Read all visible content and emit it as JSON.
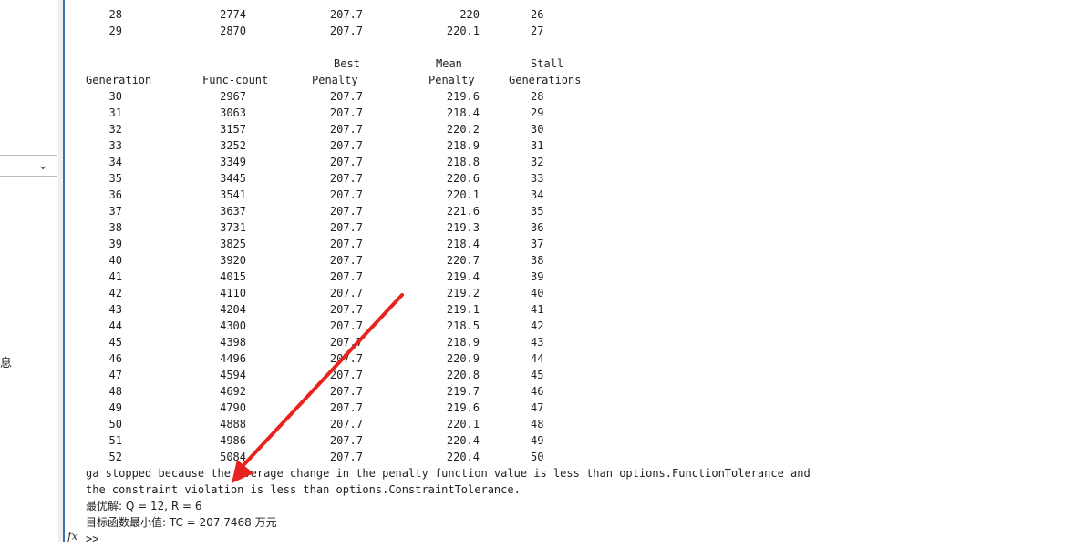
{
  "side_panel": {
    "partial_char": "息"
  },
  "console": {
    "top_rows": [
      {
        "gen": "28",
        "fc": "2774",
        "best": "207.7",
        "mean": "220",
        "stall": "26"
      },
      {
        "gen": "29",
        "fc": "2870",
        "best": "207.7",
        "mean": "220.1",
        "stall": "27"
      }
    ],
    "headers": {
      "best_top": "Best",
      "mean_top": "Mean",
      "stall_top": "Stall",
      "generation": "Generation",
      "func_count": "Func-count",
      "best_bottom": "Penalty",
      "mean_bottom": "Penalty",
      "stall_bottom": "Generations"
    },
    "rows": [
      {
        "gen": "30",
        "fc": "2967",
        "best": "207.7",
        "mean": "219.6",
        "stall": "28"
      },
      {
        "gen": "31",
        "fc": "3063",
        "best": "207.7",
        "mean": "218.4",
        "stall": "29"
      },
      {
        "gen": "32",
        "fc": "3157",
        "best": "207.7",
        "mean": "220.2",
        "stall": "30"
      },
      {
        "gen": "33",
        "fc": "3252",
        "best": "207.7",
        "mean": "218.9",
        "stall": "31"
      },
      {
        "gen": "34",
        "fc": "3349",
        "best": "207.7",
        "mean": "218.8",
        "stall": "32"
      },
      {
        "gen": "35",
        "fc": "3445",
        "best": "207.7",
        "mean": "220.6",
        "stall": "33"
      },
      {
        "gen": "36",
        "fc": "3541",
        "best": "207.7",
        "mean": "220.1",
        "stall": "34"
      },
      {
        "gen": "37",
        "fc": "3637",
        "best": "207.7",
        "mean": "221.6",
        "stall": "35"
      },
      {
        "gen": "38",
        "fc": "3731",
        "best": "207.7",
        "mean": "219.3",
        "stall": "36"
      },
      {
        "gen": "39",
        "fc": "3825",
        "best": "207.7",
        "mean": "218.4",
        "stall": "37"
      },
      {
        "gen": "40",
        "fc": "3920",
        "best": "207.7",
        "mean": "220.7",
        "stall": "38"
      },
      {
        "gen": "41",
        "fc": "4015",
        "best": "207.7",
        "mean": "219.4",
        "stall": "39"
      },
      {
        "gen": "42",
        "fc": "4110",
        "best": "207.7",
        "mean": "219.2",
        "stall": "40"
      },
      {
        "gen": "43",
        "fc": "4204",
        "best": "207.7",
        "mean": "219.1",
        "stall": "41"
      },
      {
        "gen": "44",
        "fc": "4300",
        "best": "207.7",
        "mean": "218.5",
        "stall": "42"
      },
      {
        "gen": "45",
        "fc": "4398",
        "best": "207.7",
        "mean": "218.9",
        "stall": "43"
      },
      {
        "gen": "46",
        "fc": "4496",
        "best": "207.7",
        "mean": "220.9",
        "stall": "44"
      },
      {
        "gen": "47",
        "fc": "4594",
        "best": "207.7",
        "mean": "220.8",
        "stall": "45"
      },
      {
        "gen": "48",
        "fc": "4692",
        "best": "207.7",
        "mean": "219.7",
        "stall": "46"
      },
      {
        "gen": "49",
        "fc": "4790",
        "best": "207.7",
        "mean": "219.6",
        "stall": "47"
      },
      {
        "gen": "50",
        "fc": "4888",
        "best": "207.7",
        "mean": "220.1",
        "stall": "48"
      },
      {
        "gen": "51",
        "fc": "4986",
        "best": "207.7",
        "mean": "220.4",
        "stall": "49"
      },
      {
        "gen": "52",
        "fc": "5084",
        "best": "207.7",
        "mean": "220.4",
        "stall": "50"
      }
    ],
    "stop_message_1": "ga stopped because the average change in the penalty function value is less than options.FunctionTolerance and",
    "stop_message_2": "the constraint violation is less than options.ConstraintTolerance.",
    "best_solution": "最优解: Q = 12, R = 6",
    "objective_min": "目标函数最小值: TC = 207.7468 万元",
    "prompt": ">>"
  },
  "annotation": {
    "arrow_color": "#e8231f"
  },
  "icons": {
    "fx": "fx-icon",
    "dropdown": "chevron-down-icon"
  }
}
